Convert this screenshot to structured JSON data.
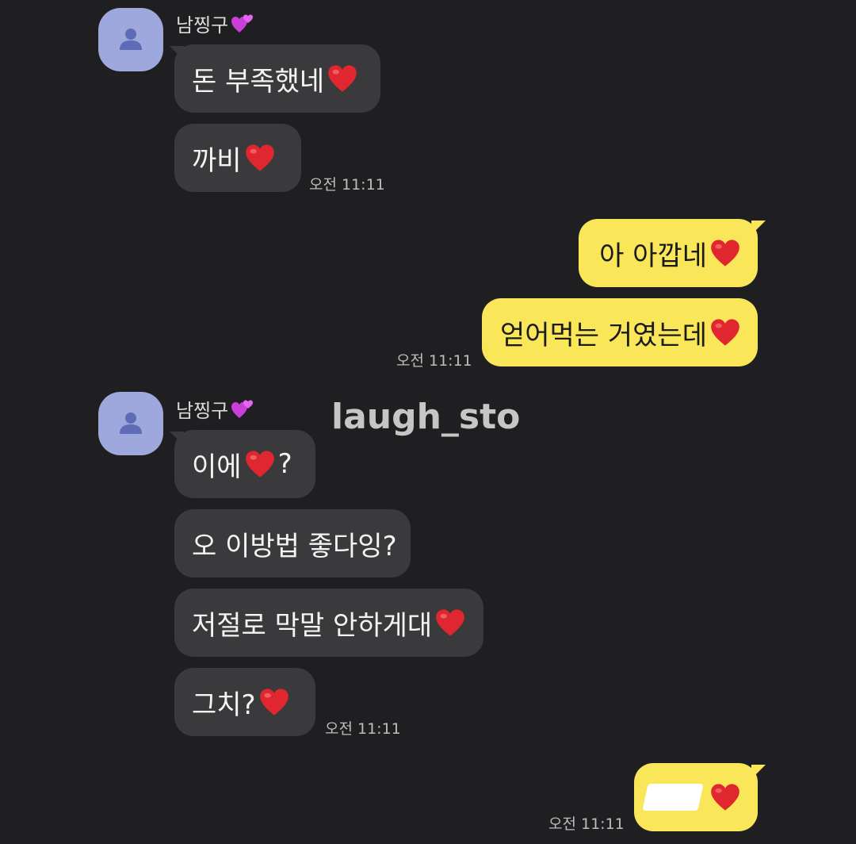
{
  "chat": {
    "groups": [
      {
        "sender": "남찡구",
        "sender_emoji": "💕",
        "messages": [
          {
            "text": "돈 부족했네",
            "heart": true
          },
          {
            "text": "까비",
            "heart": true
          }
        ],
        "time": "오전 11:11"
      },
      {
        "sender": "me",
        "messages": [
          {
            "text": "아 아깝네",
            "heart": true
          },
          {
            "text": "얻어먹는 거였는데",
            "heart": true
          }
        ],
        "time": "오전 11:11"
      },
      {
        "sender": "남찡구",
        "sender_emoji": "💕",
        "messages": [
          {
            "text": "이에",
            "heart": true,
            "suffix": "?"
          },
          {
            "text": "오 이방법 좋다잉?"
          },
          {
            "text": "저절로 막말 안하게대",
            "heart": true
          },
          {
            "text": "그치?",
            "heart": true
          }
        ],
        "time": "오전 11:11"
      },
      {
        "sender": "me",
        "messages": [
          {
            "text": "",
            "redacted": true,
            "heart": true
          }
        ],
        "time": "오전 11:11"
      }
    ]
  },
  "watermark": "laugh_sto",
  "colors": {
    "background": "#1f1f21",
    "incoming_bubble": "#3a3a3c",
    "outgoing_bubble": "#f9e659",
    "avatar": "#9fa8dc",
    "heart": "#e0262f"
  },
  "icons": {
    "avatar": "person-silhouette-icon",
    "heart": "red-heart-icon",
    "sender_badge": "two-hearts-icon"
  }
}
